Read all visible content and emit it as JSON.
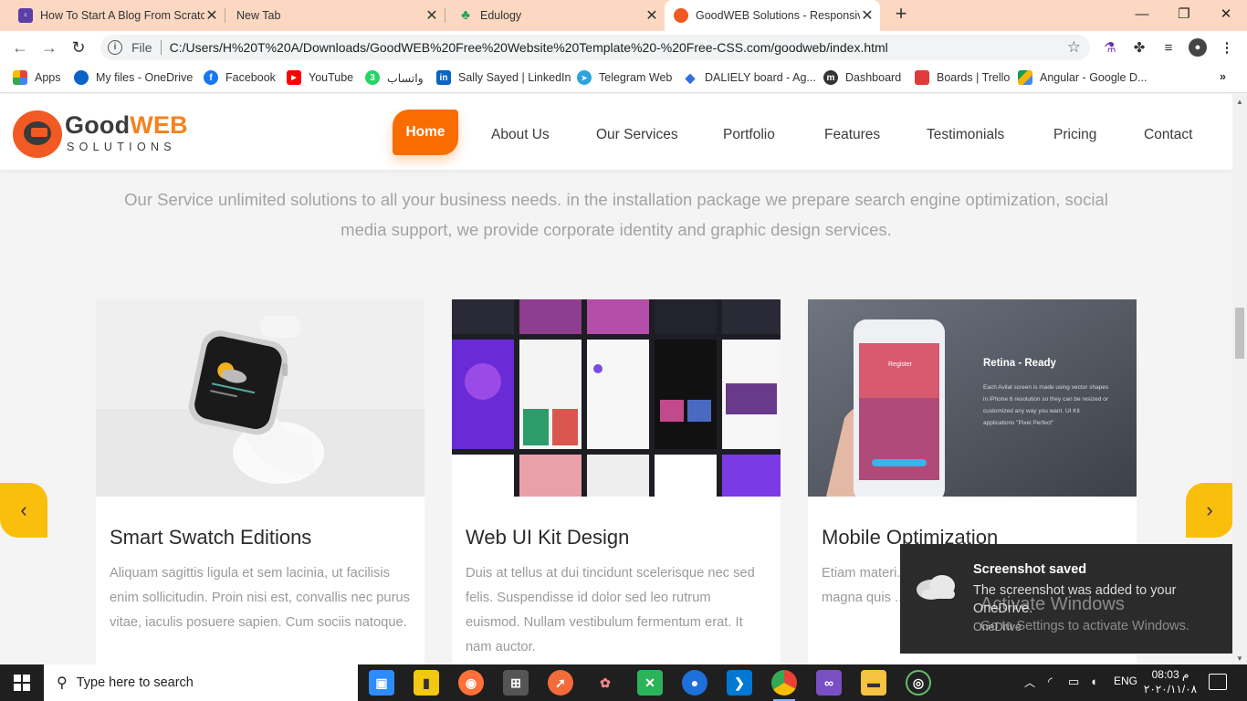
{
  "browser": {
    "tabs": [
      {
        "title": "How To Start A Blog From Scratch",
        "icon": "colorlib-favicon",
        "color": "#5b3fa8"
      },
      {
        "title": "New Tab",
        "icon": "blank-favicon",
        "color": "#ffffff"
      },
      {
        "title": "Edulogy",
        "icon": "edulogy-favicon",
        "color": "#26a65b"
      },
      {
        "title": "GoodWEB Solutions - Responsive",
        "icon": "goodweb-favicon",
        "color": "#f15a22"
      }
    ],
    "address": {
      "scheme_label": "File",
      "url": "C:/Users/H%20T%20A/Downloads/GoodWEB%20Free%20Website%20Template%20-%20Free-CSS.com/goodweb/index.html"
    },
    "bookmarks": [
      {
        "label": "Apps",
        "icon": "apps-grid-icon",
        "color": "#e44"
      },
      {
        "label": "My files - OneDrive",
        "icon": "onedrive-icon",
        "color": "#0a64c8"
      },
      {
        "label": "Facebook",
        "icon": "facebook-icon",
        "color": "#1877f2"
      },
      {
        "label": "YouTube",
        "icon": "youtube-icon",
        "color": "#ff0000"
      },
      {
        "label": "واتساب",
        "icon": "whatsapp-icon",
        "color": "#25d366"
      },
      {
        "label": "Sally Sayed | LinkedIn",
        "icon": "linkedin-icon",
        "color": "#0a66c2"
      },
      {
        "label": "Telegram Web",
        "icon": "telegram-icon",
        "color": "#2aa3df"
      },
      {
        "label": "DALIELY board - Ag...",
        "icon": "agile-icon",
        "color": "#2f6fe0"
      },
      {
        "label": "Dashboard",
        "icon": "dashboard-icon",
        "color": "#333333"
      },
      {
        "label": "Boards | Trello",
        "icon": "trello-icon",
        "color": "#e03a3a"
      },
      {
        "label": "Angular - Google D...",
        "icon": "google-drive-icon",
        "color": "#f4b400"
      }
    ]
  },
  "site": {
    "logo": {
      "word_dark": "Good",
      "word_accent": "WEB",
      "tagline": "SOLUTIONS"
    },
    "nav": [
      "Home",
      "About Us",
      "Our Services",
      "Portfolio",
      "Features",
      "Testimonials",
      "Pricing",
      "Contact"
    ],
    "intro": "Our Service unlimited solutions to all your business needs. in the installation package we prepare search engine optimization, social media support, we provide corporate identity and graphic design services.",
    "cards": [
      {
        "title": "Smart Swatch Editions",
        "text": "Aliquam sagittis ligula et sem lacinia, ut facilisis enim sollicitudin. Proin nisi est, convallis nec purus vitae, iaculis posuere sapien. Cum sociis natoque."
      },
      {
        "title": "Web UI Kit Design",
        "text": "Duis at tellus at dui tincidunt scelerisque nec sed felis. Suspendisse id dolor sed leo rutrum euismod. Nullam vestibulum fermentum erat. It nam auctor."
      },
      {
        "title": "Mobile Optimization",
        "text": "Etiam materi... nulla. Etiam s... aliquam at e... magna quis ..."
      }
    ],
    "card3_overlay": {
      "heading": "Retina - Ready",
      "body": "Each Avilal screen is made using vector shapes in iPhone 6 resolution so they can be resized or customized any way you want. UI Kit applications \"Pixel Perfect\"",
      "phone_label": "Register"
    }
  },
  "toast": {
    "title": "Screenshot saved",
    "body": "The screenshot was added to your OneDrive.",
    "source": "OneDrive"
  },
  "watermark": {
    "line1": "Activate Windows",
    "line2": "Go to Settings to activate Windows."
  },
  "taskbar": {
    "search_placeholder": "Type here to search",
    "language": "ENG",
    "time": "08:03 م",
    "date": "٢٠٢٠/١١/٠٨"
  },
  "colors": {
    "accent_orange": "#f96d00",
    "arrow_yellow": "#f9bf0c",
    "tabstrip": "#fcd8c2"
  }
}
